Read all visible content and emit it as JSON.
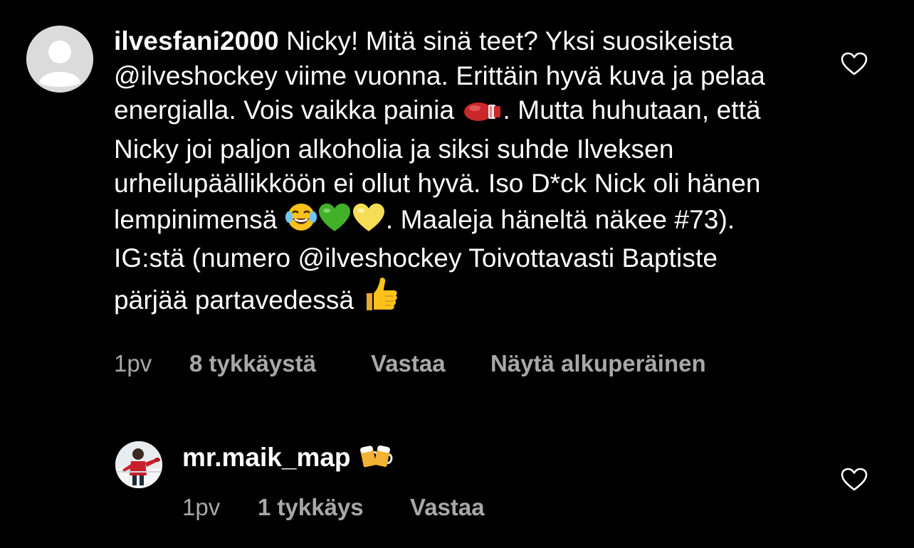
{
  "comment1": {
    "username": "ilvesfani2000",
    "text_part1": " Nicky! Mitä sinä teet? Yksi suosikeista @ilveshockey viime vuonna. Erittäin hyvä kuva ja pelaa energialla. Vois vaikka painia ",
    "text_part2": ". Mutta huhutaan, että Nicky joi paljon alkoholia ja siksi suhde Ilveksen urheilupäällikköön ei ollut hyvä. Iso D*ck Nick oli hänen lempinimensä ",
    "text_part3": ". Maaleja häneltä näkee #73). IG:stä (numero @ilveshockey Toivottavasti Baptiste pärjää partavedessä ",
    "emojis": [
      "boxing-glove-icon",
      "laughing-tears-icon",
      "green-heart-icon",
      "yellow-heart-icon",
      "thumbs-up-icon"
    ],
    "time": "1pv",
    "likes": "8 tykkäystä",
    "reply": "Vastaa",
    "see_original": "Näytä alkuperäinen"
  },
  "comment2": {
    "username": "mr.maik_map",
    "emoji": "beer-mugs-icon",
    "time": "1pv",
    "likes": "1 tykkäys",
    "reply": "Vastaa"
  },
  "colors": {
    "background": "#000000",
    "text": "#ffffff",
    "meta_text": "#a8a8a8",
    "avatar_placeholder": "#dbdbdb"
  }
}
